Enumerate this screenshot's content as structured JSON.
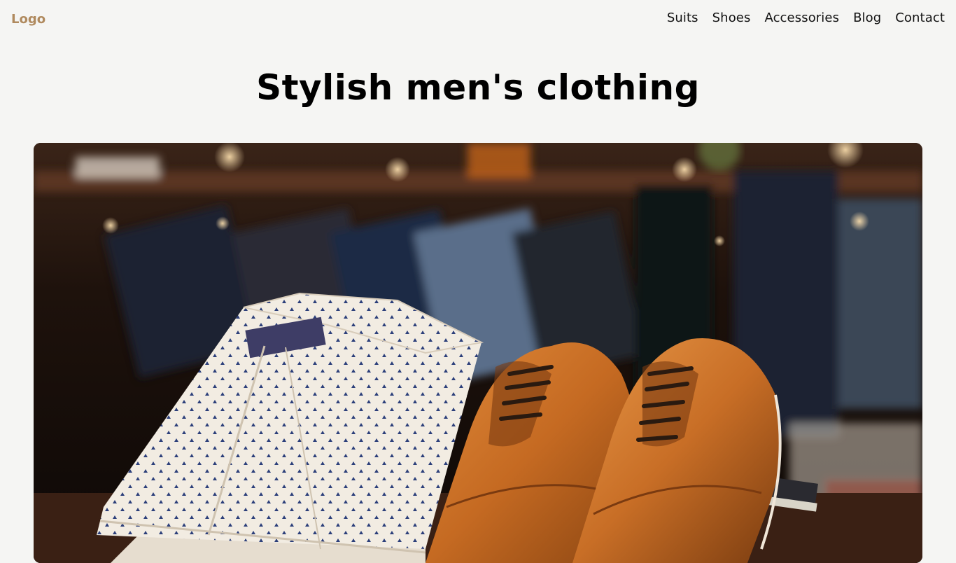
{
  "header": {
    "logo": "Logo",
    "nav": [
      "Suits",
      "Shoes",
      "Accessories",
      "Blog",
      "Contact"
    ]
  },
  "page": {
    "title": "Stylish men's clothing"
  },
  "hero": {
    "alt": "Folded patterned shirts and brown leather oxford shoes in a clothing store"
  }
}
